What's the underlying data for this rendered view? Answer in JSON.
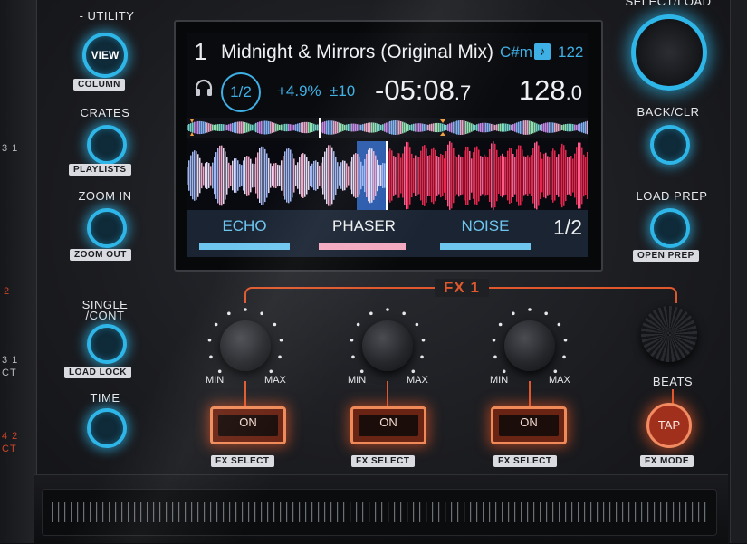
{
  "left_panel": {
    "utility": "UTILITY",
    "view_label": "VIEW",
    "column": "COLUMN",
    "crates": "CRATES",
    "playlists": "PLAYLISTS",
    "zoom_in": "ZOOM IN",
    "zoom_out": "ZOOM OUT",
    "single_line1": "SINGLE",
    "single_line2": "/CONT",
    "load_lock": "LOAD LOCK",
    "time": "TIME"
  },
  "edge_labels": [
    "3 1",
    "2",
    "3 1",
    "CT",
    "4 2",
    "CT"
  ],
  "right_panel": {
    "select_load": "SELECT/LOAD",
    "back_clr": "BACK/CLR",
    "load_prep": "LOAD PREP",
    "open_prep": "OPEN PREP"
  },
  "screen": {
    "deck": "1",
    "title": "Midnight & Mirrors (Original Mix)",
    "key": "C#m",
    "key_icon": "♪",
    "key_bpm": "122",
    "beat": "1/2",
    "tempo": "+4.9%",
    "range": "±10",
    "time_main": "-05:08",
    "time_frac": ".7",
    "bpm_main": "128",
    "bpm_frac": ".0",
    "fx": [
      {
        "name": "ECHO",
        "color": "#6ec6ef",
        "bar": "#6ec6ef"
      },
      {
        "name": "PHASER",
        "color": "#eef0f2",
        "bar": "#f3a9c0"
      },
      {
        "name": "NOISE",
        "color": "#6ec6ef",
        "bar": "#6ec6ef"
      }
    ],
    "page": "1/2"
  },
  "fx_section": {
    "title": "FX 1",
    "min": "MIN",
    "max": "MAX",
    "on": "ON",
    "fx_select": "FX SELECT",
    "beats": "BEATS",
    "tap": "TAP",
    "fx_mode": "FX MODE"
  },
  "colors": {
    "accent_blue": "#2fb6e8",
    "accent_orange": "#e0582d"
  }
}
